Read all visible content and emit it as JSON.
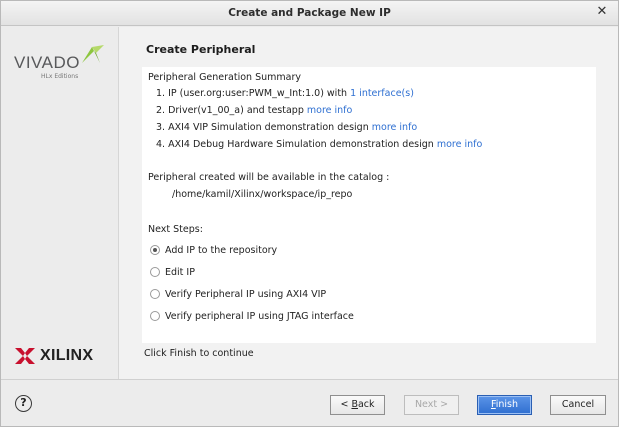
{
  "window": {
    "title": "Create and Package New IP",
    "close_glyph": "✕"
  },
  "sidebar": {
    "product_name": "VIVADO",
    "product_edition": "HLx Editions",
    "vendor_name": "XILINX",
    "colors": {
      "vivado_green": "#8dc63f",
      "xilinx_red": "#c8102e",
      "logo_gray": "#58595b"
    }
  },
  "page": {
    "title": "Create Peripheral",
    "summary": {
      "heading": "Peripheral Generation Summary",
      "items": [
        {
          "text": "1. IP (user.org:user:PWM_w_Int:1.0) with",
          "link": "1 interface(s)"
        },
        {
          "text": "2. Driver(v1_00_a) and testapp",
          "link": "more info"
        },
        {
          "text": "3. AXI4 VIP Simulation demonstration design",
          "link": "more info"
        },
        {
          "text": "4. AXI4 Debug Hardware Simulation demonstration design",
          "link": "more info"
        }
      ]
    },
    "catalog": {
      "label": "Peripheral created will be available in the catalog :",
      "path": "/home/kamil/Xilinx/workspace/ip_repo"
    },
    "next_steps": {
      "heading": "Next Steps:",
      "options": [
        {
          "label": "Add IP to the repository",
          "selected": true
        },
        {
          "label": "Edit IP",
          "selected": false
        },
        {
          "label": "Verify Peripheral IP using AXI4 VIP",
          "selected": false
        },
        {
          "label": "Verify peripheral IP using JTAG interface",
          "selected": false
        }
      ]
    },
    "hint": "Click Finish to continue",
    "link_color": "#2e6fd1"
  },
  "footer": {
    "help_glyph": "?",
    "back_prefix": "< ",
    "back_mnemonic": "B",
    "back_rest": "ack",
    "next_label": "Next >",
    "finish_mnemonic": "F",
    "finish_rest": "inish",
    "cancel_label": "Cancel",
    "primary_color": "#2f6fd0"
  }
}
